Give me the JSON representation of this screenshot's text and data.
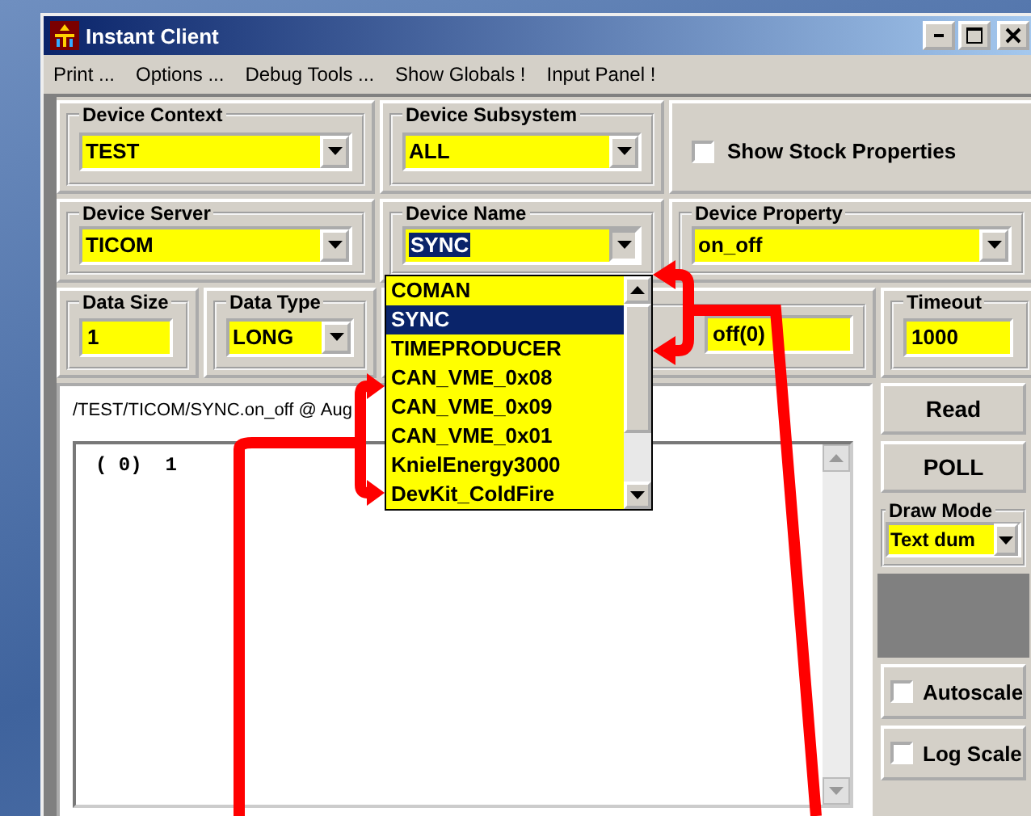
{
  "window": {
    "title": "Instant Client"
  },
  "menu": [
    "Print ...",
    "Options ...",
    "Debug Tools ...",
    "Show Globals !",
    "Input Panel !"
  ],
  "device_context": {
    "label": "Device Context",
    "value": "TEST"
  },
  "device_subsystem": {
    "label": "Device Subsystem",
    "value": "ALL"
  },
  "show_stock_properties": {
    "label": "Show Stock Properties",
    "checked": false
  },
  "device_server": {
    "label": "Device Server",
    "value": "TICOM"
  },
  "device_name": {
    "label": "Device Name",
    "value": "SYNC",
    "expanded": true,
    "options": [
      {
        "label": "COMAN",
        "selected": false
      },
      {
        "label": "SYNC",
        "selected": true
      },
      {
        "label": "TIMEPRODUCER",
        "selected": false
      },
      {
        "label": "CAN_VME_0x08",
        "selected": false
      },
      {
        "label": "CAN_VME_0x09",
        "selected": false
      },
      {
        "label": "CAN_VME_0x01",
        "selected": false
      },
      {
        "label": "KnielEnergy3000",
        "selected": false
      },
      {
        "label": "DevKit_ColdFire",
        "selected": false
      }
    ]
  },
  "device_property": {
    "label": "Device Property",
    "value": "on_off"
  },
  "data_size": {
    "label": "Data Size",
    "value": "1"
  },
  "data_type": {
    "label": "Data Type",
    "value": "LONG"
  },
  "column_3": {
    "value": "off(0)"
  },
  "timeout": {
    "label": "Timeout",
    "value": "1000"
  },
  "output": {
    "path": "/TEST/TICOM/SYNC.on_off @ Aug",
    "lines": [
      "( 0)  1"
    ]
  },
  "buttons": [
    "Read",
    "POLL"
  ],
  "draw_mode": {
    "label": "Draw Mode",
    "value": "Text dum"
  },
  "toggles": [
    {
      "label": "Autoscale",
      "checked": false
    },
    {
      "label": "Log Scale",
      "checked": false
    }
  ]
}
